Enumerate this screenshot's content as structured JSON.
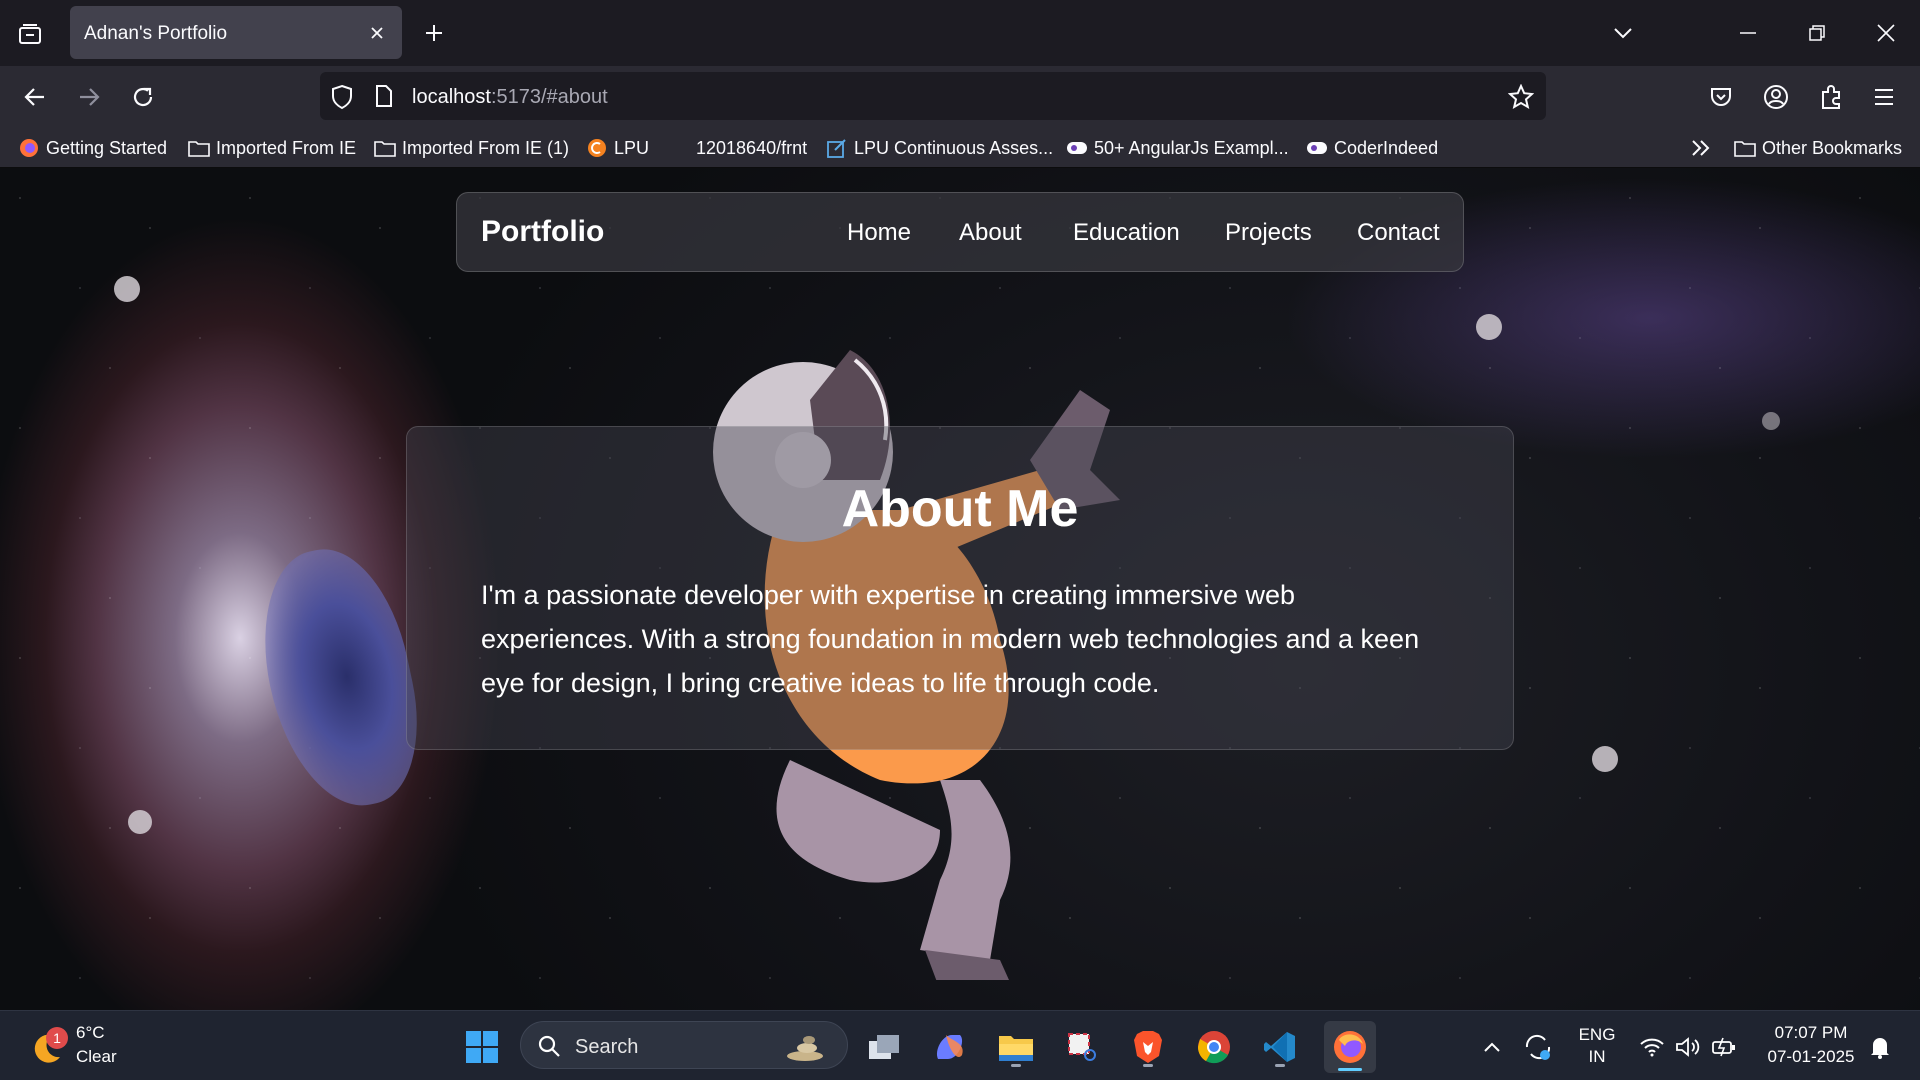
{
  "browser": {
    "tab_title": "Adnan's Portfolio",
    "url_host": "localhost",
    "url_rest": ":5173/#about"
  },
  "bookmarks": [
    {
      "label": "Getting Started",
      "icon": "firefox-icon"
    },
    {
      "label": "Imported From IE",
      "icon": "folder-icon"
    },
    {
      "label": "Imported From IE (1)",
      "icon": "folder-icon"
    },
    {
      "label": "LPU",
      "icon": "lpu-icon"
    },
    {
      "label": "12018640/frnt",
      "icon": "none"
    },
    {
      "label": "LPU Continuous Asses...",
      "icon": "edit-icon"
    },
    {
      "label": "50+ AngularJs Exampl...",
      "icon": "site-icon"
    },
    {
      "label": "CoderIndeed",
      "icon": "site-icon"
    }
  ],
  "bookmarks_more": "Other Bookmarks",
  "site": {
    "brand": "Portfolio",
    "nav": [
      "Home",
      "About",
      "Education",
      "Projects",
      "Contact"
    ],
    "about_title": "About Me",
    "about_text": "I'm a passionate developer with expertise in creating immersive web experiences. With a strong foundation in modern web technologies and a keen eye for design, I bring creative ideas to life through code."
  },
  "taskbar": {
    "weather_temp": "6°C",
    "weather_desc": "Clear",
    "weather_badge": "1",
    "search_placeholder": "Search",
    "lang_1": "ENG",
    "lang_2": "IN",
    "time": "07:07 PM",
    "date": "07-01-2025"
  },
  "colors": {
    "accent_orange": "#fb9a4b",
    "browser_bg": "#1c1b22",
    "taskbar_bg": "#1f2430"
  }
}
